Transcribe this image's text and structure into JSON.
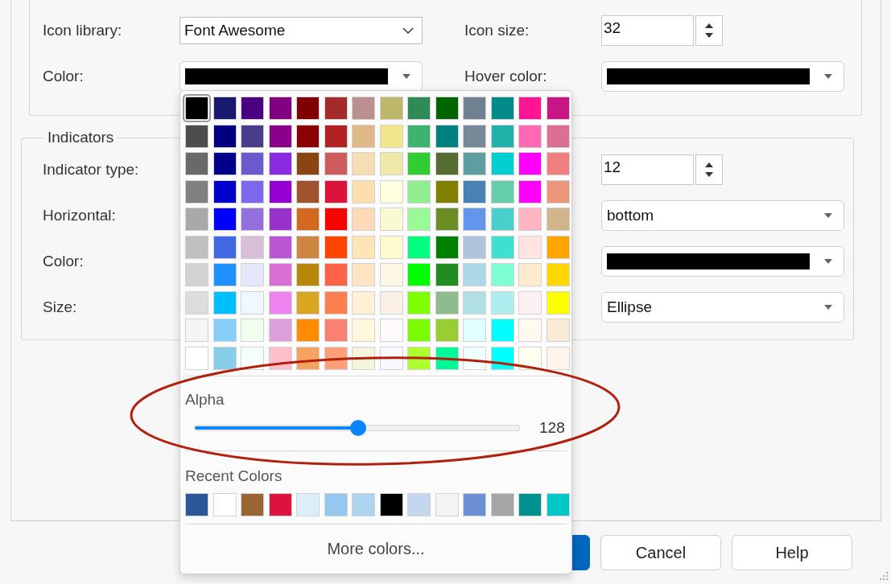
{
  "settings_group": {
    "rows": [
      {
        "left": {
          "label": "Icon library:",
          "kind": "select",
          "value": "Font Awesome"
        },
        "right": {
          "label": "Icon size:",
          "kind": "spinner",
          "value": "32"
        }
      },
      {
        "left": {
          "label": "Color:",
          "kind": "color",
          "color": "#000000"
        },
        "right": {
          "label": "Hover color:",
          "kind": "color",
          "color": "#000000"
        }
      }
    ]
  },
  "indicators_group": {
    "title": "Indicators",
    "rows": [
      {
        "left": {
          "label": "Indicator type:"
        },
        "right": {
          "kind": "spinner",
          "value": "12"
        }
      },
      {
        "left": {
          "label": "Horizontal:"
        },
        "right": {
          "kind": "combo",
          "value": "bottom"
        }
      },
      {
        "left": {
          "label": "Color:"
        },
        "right": {
          "kind": "color",
          "color": "#000000"
        }
      },
      {
        "left": {
          "label": "Size:"
        },
        "right": {
          "kind": "combo",
          "value": "Ellipse"
        }
      }
    ]
  },
  "buttons": [
    {
      "kind": "primary"
    },
    {
      "kind": "default",
      "label": "Cancel"
    },
    {
      "kind": "default",
      "label": "Help"
    }
  ],
  "color_popup": {
    "swatches": [
      {
        "color": "#000000",
        "selected": true
      },
      {
        "color": "#191970",
        "selected": false
      },
      {
        "color": "#4b0082",
        "selected": false
      },
      {
        "color": "#800080",
        "selected": false
      },
      {
        "color": "#800000",
        "selected": false
      },
      {
        "color": "#a52a2a",
        "selected": false
      },
      {
        "color": "#bc8f8f",
        "selected": false
      },
      {
        "color": "#bdb76b",
        "selected": false
      },
      {
        "color": "#2e8b57",
        "selected": false
      },
      {
        "color": "#006400",
        "selected": false
      },
      {
        "color": "#708090",
        "selected": false
      },
      {
        "color": "#008b8b",
        "selected": false
      },
      {
        "color": "#ff1493",
        "selected": false
      },
      {
        "color": "#c71585",
        "selected": false
      },
      {
        "color": "#4d4d4d",
        "selected": false
      },
      {
        "color": "#000080",
        "selected": false
      },
      {
        "color": "#483d8b",
        "selected": false
      },
      {
        "color": "#8b008b",
        "selected": false
      },
      {
        "color": "#8b0000",
        "selected": false
      },
      {
        "color": "#b22222",
        "selected": false
      },
      {
        "color": "#deb887",
        "selected": false
      },
      {
        "color": "#f0e68c",
        "selected": false
      },
      {
        "color": "#3cb371",
        "selected": false
      },
      {
        "color": "#008080",
        "selected": false
      },
      {
        "color": "#778899",
        "selected": false
      },
      {
        "color": "#20b2aa",
        "selected": false
      },
      {
        "color": "#ff69b4",
        "selected": false
      },
      {
        "color": "#db7093",
        "selected": false
      },
      {
        "color": "#696969",
        "selected": false
      },
      {
        "color": "#00008b",
        "selected": false
      },
      {
        "color": "#6a5acd",
        "selected": false
      },
      {
        "color": "#8a2be2",
        "selected": false
      },
      {
        "color": "#8b4513",
        "selected": false
      },
      {
        "color": "#cd5c5c",
        "selected": false
      },
      {
        "color": "#f5deb3",
        "selected": false
      },
      {
        "color": "#eee8aa",
        "selected": false
      },
      {
        "color": "#32cd32",
        "selected": false
      },
      {
        "color": "#556b2f",
        "selected": false
      },
      {
        "color": "#5f9ea0",
        "selected": false
      },
      {
        "color": "#00ced1",
        "selected": false
      },
      {
        "color": "#ff00fe",
        "selected": false
      },
      {
        "color": "#f08080",
        "selected": false
      },
      {
        "color": "#808080",
        "selected": false
      },
      {
        "color": "#0000cd",
        "selected": false
      },
      {
        "color": "#7b68ee",
        "selected": false
      },
      {
        "color": "#9400d3",
        "selected": false
      },
      {
        "color": "#a0522d",
        "selected": false
      },
      {
        "color": "#dc143c",
        "selected": false
      },
      {
        "color": "#ffdead",
        "selected": false
      },
      {
        "color": "#ffffe0",
        "selected": false
      },
      {
        "color": "#90ee90",
        "selected": false
      },
      {
        "color": "#808000",
        "selected": false
      },
      {
        "color": "#4682b4",
        "selected": false
      },
      {
        "color": "#66cdaa",
        "selected": false
      },
      {
        "color": "#ff00ff",
        "selected": false
      },
      {
        "color": "#e9967a",
        "selected": false
      },
      {
        "color": "#a9a9a9",
        "selected": false
      },
      {
        "color": "#0000ff",
        "selected": false
      },
      {
        "color": "#9370db",
        "selected": false
      },
      {
        "color": "#9932cc",
        "selected": false
      },
      {
        "color": "#d2691e",
        "selected": false
      },
      {
        "color": "#ff0000",
        "selected": false
      },
      {
        "color": "#ffdab9",
        "selected": false
      },
      {
        "color": "#fafad2",
        "selected": false
      },
      {
        "color": "#98fb98",
        "selected": false
      },
      {
        "color": "#6b8e23",
        "selected": false
      },
      {
        "color": "#6495ed",
        "selected": false
      },
      {
        "color": "#48d1cc",
        "selected": false
      },
      {
        "color": "#ffb6c1",
        "selected": false
      },
      {
        "color": "#d2b48c",
        "selected": false
      },
      {
        "color": "#c0c0c0",
        "selected": false
      },
      {
        "color": "#4169e1",
        "selected": false
      },
      {
        "color": "#d8bfd8",
        "selected": false
      },
      {
        "color": "#ba55d3",
        "selected": false
      },
      {
        "color": "#cd853f",
        "selected": false
      },
      {
        "color": "#ff4500",
        "selected": false
      },
      {
        "color": "#ffe4b5",
        "selected": false
      },
      {
        "color": "#fffacd",
        "selected": false
      },
      {
        "color": "#00ff7f",
        "selected": false
      },
      {
        "color": "#008000",
        "selected": false
      },
      {
        "color": "#b0c4de",
        "selected": false
      },
      {
        "color": "#40e0d0",
        "selected": false
      },
      {
        "color": "#ffe4e1",
        "selected": false
      },
      {
        "color": "#ffa500",
        "selected": false
      },
      {
        "color": "#d3d3d3",
        "selected": false
      },
      {
        "color": "#1e90ff",
        "selected": false
      },
      {
        "color": "#e6e6fa",
        "selected": false
      },
      {
        "color": "#da70d6",
        "selected": false
      },
      {
        "color": "#b8860b",
        "selected": false
      },
      {
        "color": "#ff6347",
        "selected": false
      },
      {
        "color": "#ffe4c4",
        "selected": false
      },
      {
        "color": "#fdf5e6",
        "selected": false
      },
      {
        "color": "#00ff00",
        "selected": false
      },
      {
        "color": "#228b22",
        "selected": false
      },
      {
        "color": "#add8e6",
        "selected": false
      },
      {
        "color": "#7fffd4",
        "selected": false
      },
      {
        "color": "#ffebcd",
        "selected": false
      },
      {
        "color": "#ffd700",
        "selected": false
      },
      {
        "color": "#dcdcdc",
        "selected": false
      },
      {
        "color": "#00bfff",
        "selected": false
      },
      {
        "color": "#f0f8ff",
        "selected": false
      },
      {
        "color": "#ee82ee",
        "selected": false
      },
      {
        "color": "#daa520",
        "selected": false
      },
      {
        "color": "#ff7f50",
        "selected": false
      },
      {
        "color": "#ffefd5",
        "selected": false
      },
      {
        "color": "#faf0e6",
        "selected": false
      },
      {
        "color": "#7fff00",
        "selected": false
      },
      {
        "color": "#8fbc8f",
        "selected": false
      },
      {
        "color": "#b0e0e6",
        "selected": false
      },
      {
        "color": "#afeeee",
        "selected": false
      },
      {
        "color": "#fff0f5",
        "selected": false
      },
      {
        "color": "#ffff00",
        "selected": false
      },
      {
        "color": "#f5f5f5",
        "selected": false
      },
      {
        "color": "#87cefa",
        "selected": false
      },
      {
        "color": "#f0fff0",
        "selected": false
      },
      {
        "color": "#dda0dd",
        "selected": false
      },
      {
        "color": "#ff8c00",
        "selected": false
      },
      {
        "color": "#fa8072",
        "selected": false
      },
      {
        "color": "#fff8dc",
        "selected": false
      },
      {
        "color": "#fffafa",
        "selected": false
      },
      {
        "color": "#7cfc00",
        "selected": false
      },
      {
        "color": "#9acd32",
        "selected": false
      },
      {
        "color": "#e0ffff",
        "selected": false
      },
      {
        "color": "#00fffe",
        "selected": false
      },
      {
        "color": "#fffaf0",
        "selected": false
      },
      {
        "color": "#faebd7",
        "selected": false
      },
      {
        "color": "#ffffff",
        "selected": false
      },
      {
        "color": "#87ceeb",
        "selected": false
      },
      {
        "color": "#f5fffa",
        "selected": false
      },
      {
        "color": "#ffc0cb",
        "selected": false
      },
      {
        "color": "#f4a460",
        "selected": false
      },
      {
        "color": "#ffa07a",
        "selected": false
      },
      {
        "color": "#f5f5dc",
        "selected": false
      },
      {
        "color": "#f8f8ff",
        "selected": false
      },
      {
        "color": "#adff2f",
        "selected": false
      },
      {
        "color": "#00fa9a",
        "selected": false
      },
      {
        "color": "#f0ffff",
        "selected": false
      },
      {
        "color": "#00ffff",
        "selected": false
      },
      {
        "color": "#fffff0",
        "selected": false
      },
      {
        "color": "#fff5ee",
        "selected": false
      }
    ],
    "alpha": {
      "label": "Alpha",
      "level": 0.502,
      "reading": "128"
    },
    "recent": {
      "title": "Recent Colors",
      "swatches": [
        {
          "color": "#2b579a"
        },
        {
          "color": "#fffffe"
        },
        {
          "color": "#996633"
        },
        {
          "color": "#dc143d"
        },
        {
          "color": "#ddeef8"
        },
        {
          "color": "#94c8ee"
        },
        {
          "color": "#aed4f0"
        },
        {
          "color": "#000001"
        },
        {
          "color": "#c6d6ef"
        },
        {
          "color": "#f4f4f4"
        },
        {
          "color": "#6a8fd4"
        },
        {
          "color": "#a6a6a6"
        },
        {
          "color": "#009090"
        },
        {
          "color": "#00c8c8"
        }
      ]
    },
    "more_colors": "More colors..."
  }
}
